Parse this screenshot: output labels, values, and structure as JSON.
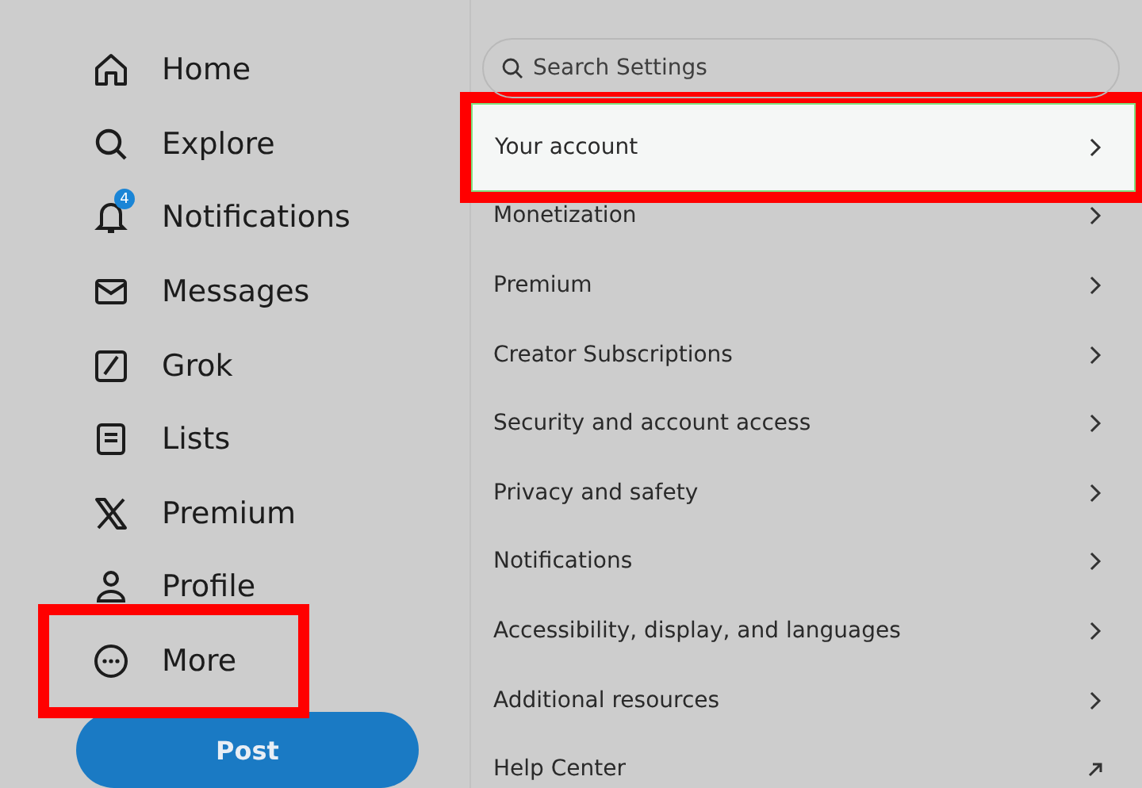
{
  "nav": {
    "items": [
      {
        "label": "Home",
        "kind": "home",
        "highlighted": false
      },
      {
        "label": "Explore",
        "kind": "search",
        "highlighted": false
      },
      {
        "label": "Notifications",
        "kind": "bell",
        "badge": "4",
        "highlighted": false
      },
      {
        "label": "Messages",
        "kind": "mail",
        "highlighted": false
      },
      {
        "label": "Grok",
        "kind": "slash",
        "highlighted": false
      },
      {
        "label": "Lists",
        "kind": "list",
        "highlighted": false
      },
      {
        "label": "Premium",
        "kind": "x",
        "highlighted": false
      },
      {
        "label": "Profile",
        "kind": "person",
        "highlighted": false
      },
      {
        "label": "More",
        "kind": "more",
        "highlighted": true
      }
    ],
    "post_button": "Post"
  },
  "settings": {
    "search": {
      "placeholder": "Search Settings"
    },
    "items": [
      {
        "label": "Your account",
        "kind": "chevron",
        "highlighted": true
      },
      {
        "label": "Monetization",
        "kind": "chevron",
        "highlighted": false
      },
      {
        "label": "Premium",
        "kind": "chevron",
        "highlighted": false
      },
      {
        "label": "Creator Subscriptions",
        "kind": "chevron",
        "highlighted": false
      },
      {
        "label": "Security and account access",
        "kind": "chevron",
        "highlighted": false
      },
      {
        "label": "Privacy and safety",
        "kind": "chevron",
        "highlighted": false
      },
      {
        "label": "Notifications",
        "kind": "chevron",
        "highlighted": false
      },
      {
        "label": "Accessibility, display, and languages",
        "kind": "chevron",
        "highlighted": false
      },
      {
        "label": "Additional resources",
        "kind": "chevron",
        "highlighted": false
      },
      {
        "label": "Help Center",
        "kind": "external",
        "highlighted": false
      }
    ]
  }
}
